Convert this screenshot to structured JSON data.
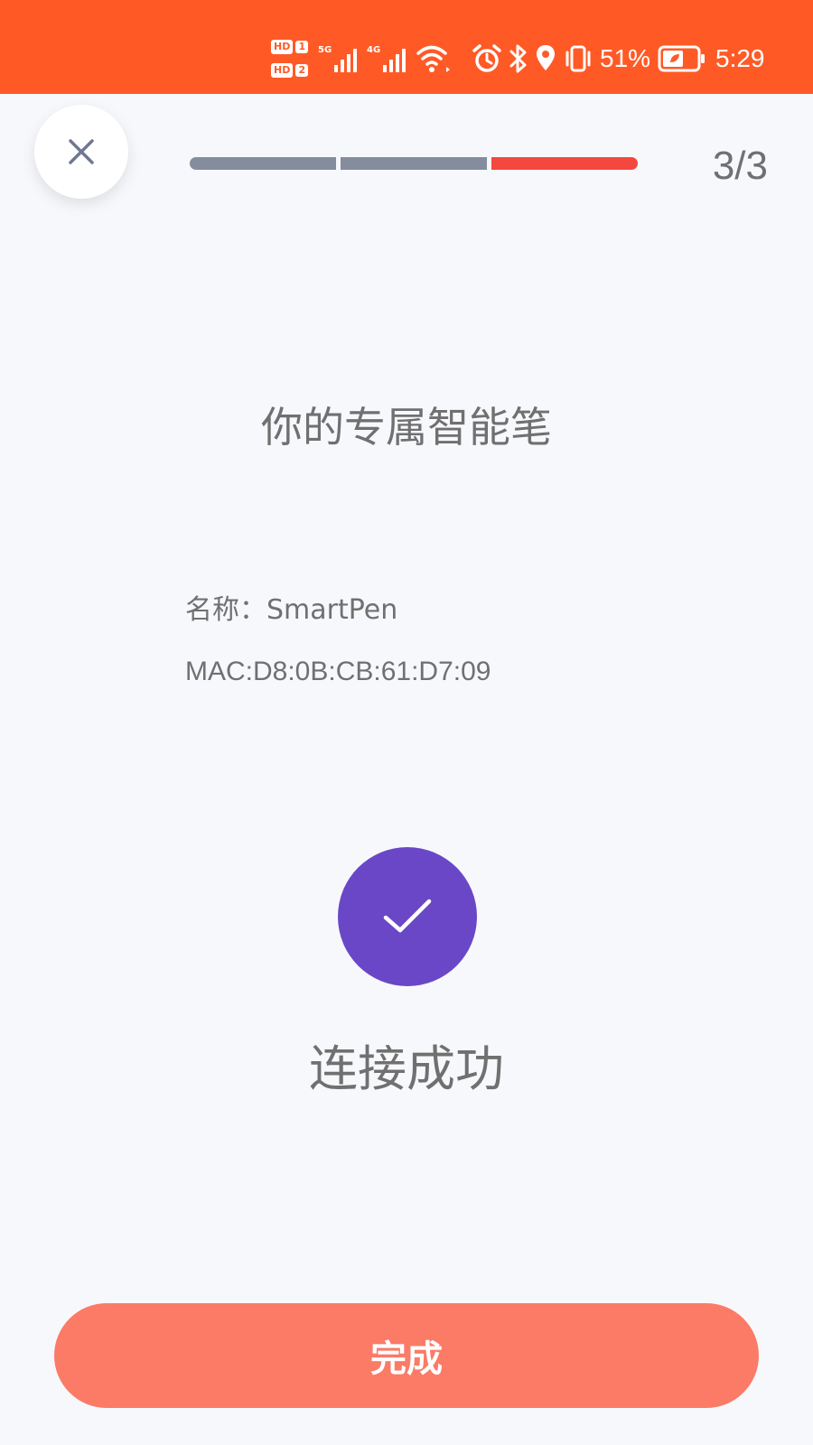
{
  "status_bar": {
    "hd_badges": [
      "HD",
      "HD"
    ],
    "sim_numbers": [
      "1",
      "2"
    ],
    "network_1": "5G",
    "network_2": "4G",
    "icons": [
      "signal-icon",
      "wifi-icon",
      "alarm-icon",
      "bluetooth-icon",
      "location-icon",
      "vibrate-icon",
      "battery-icon"
    ],
    "battery_percent": "51%",
    "time": "5:29"
  },
  "nav": {
    "close_icon": "close-icon",
    "step_counter": "3/3",
    "progress": {
      "total_steps": 3,
      "current_step": 3
    }
  },
  "content": {
    "title": "你的专属智能笔",
    "device_name": "名称：SmartPen",
    "device_mac": "MAC:D8:0B:CB:61:D7:09",
    "success_icon": "check-icon",
    "success_text": "连接成功"
  },
  "footer": {
    "done_label": "完成"
  },
  "colors": {
    "status_bar": "#ff5a26",
    "progress_inactive": "#858c9d",
    "progress_active": "#f4473f",
    "success_circle": "#6a47c6",
    "done_button": "#fb7b67",
    "background": "#f7f8fc",
    "text": "#707070"
  }
}
